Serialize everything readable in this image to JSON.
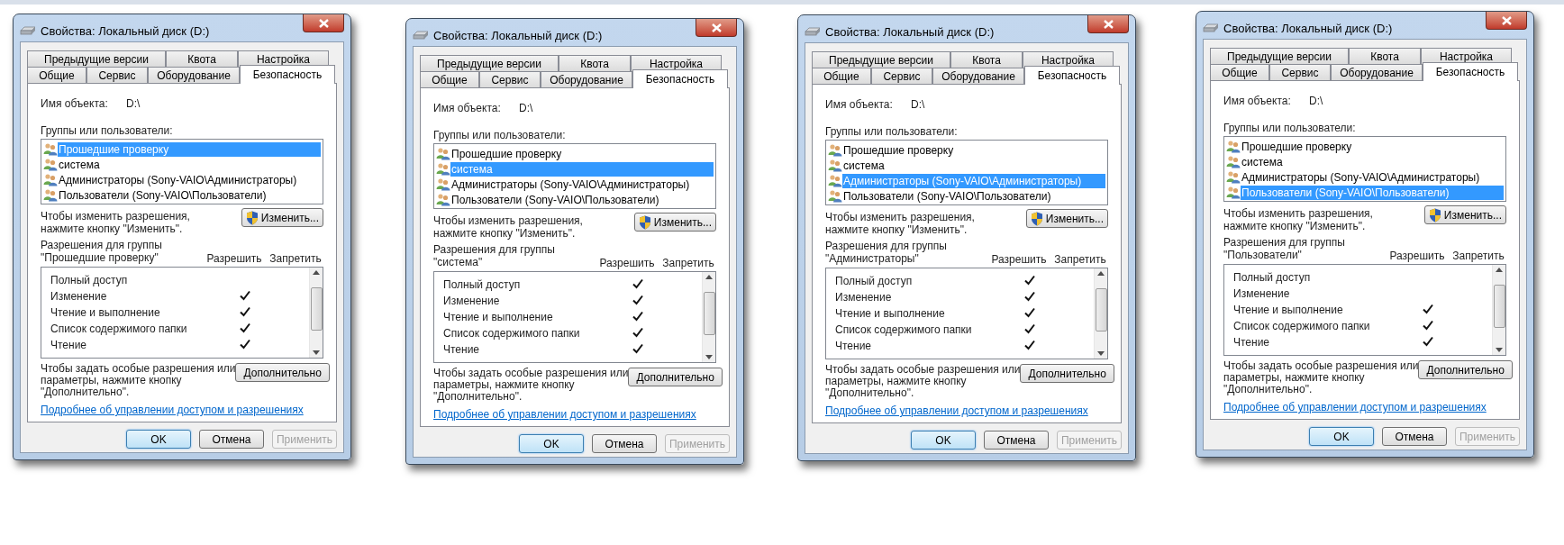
{
  "dialogs": [
    {
      "title": "Свойства: Локальный диск (D:)",
      "tabs_top": [
        {
          "label": "Предыдущие версии",
          "selected": false
        },
        {
          "label": "Квота",
          "selected": false
        },
        {
          "label": "Настройка",
          "selected": false
        }
      ],
      "tabs_bottom": [
        {
          "label": "Общие",
          "selected": false
        },
        {
          "label": "Сервис",
          "selected": false
        },
        {
          "label": "Оборудование",
          "selected": false
        },
        {
          "label": "Безопасность",
          "selected": true
        }
      ],
      "object_label": "Имя объекта:",
      "object_value": "D:\\",
      "groups_label": "Группы или пользователи:",
      "principals": [
        {
          "name": "Прошедшие проверку",
          "selected": true
        },
        {
          "name": "система",
          "selected": false
        },
        {
          "name": "Администраторы (Sony-VAIO\\Администраторы)",
          "selected": false
        },
        {
          "name": "Пользователи (Sony-VAIO\\Пользователи)",
          "selected": false
        }
      ],
      "change_hint": "Чтобы изменить разрешения,\nнажмите кнопку \"Изменить\".",
      "change_button": "Изменить...",
      "permissions_label": "Разрешения для группы\n\"Прошедшие проверку\"",
      "allow_header": "Разрешить",
      "deny_header": "Запретить",
      "permissions": [
        {
          "name": "Полный доступ",
          "allow": false,
          "deny": false
        },
        {
          "name": "Изменение",
          "allow": true,
          "deny": false
        },
        {
          "name": "Чтение и выполнение",
          "allow": true,
          "deny": false
        },
        {
          "name": "Список содержимого папки",
          "allow": true,
          "deny": false
        },
        {
          "name": "Чтение",
          "allow": true,
          "deny": false
        }
      ],
      "advanced_hint": "Чтобы задать особые разрешения или\nпараметры, нажмите кнопку\n\"Дополнительно\".",
      "advanced_button": "Дополнительно",
      "help_link": "Подробнее об управлении доступом и разрешениях",
      "buttons": [
        {
          "label": "OK",
          "default": true,
          "disabled": false
        },
        {
          "label": "Отмена",
          "default": false,
          "disabled": false
        },
        {
          "label": "Применить",
          "default": false,
          "disabled": true
        }
      ]
    },
    {
      "title": "Свойства: Локальный диск (D:)",
      "tabs_top": [
        {
          "label": "Предыдущие версии",
          "selected": false
        },
        {
          "label": "Квота",
          "selected": false
        },
        {
          "label": "Настройка",
          "selected": false
        }
      ],
      "tabs_bottom": [
        {
          "label": "Общие",
          "selected": false
        },
        {
          "label": "Сервис",
          "selected": false
        },
        {
          "label": "Оборудование",
          "selected": false
        },
        {
          "label": "Безопасность",
          "selected": true
        }
      ],
      "object_label": "Имя объекта:",
      "object_value": "D:\\",
      "groups_label": "Группы или пользователи:",
      "principals": [
        {
          "name": "Прошедшие проверку",
          "selected": false
        },
        {
          "name": "система",
          "selected": true
        },
        {
          "name": "Администраторы (Sony-VAIO\\Администраторы)",
          "selected": false
        },
        {
          "name": "Пользователи (Sony-VAIO\\Пользователи)",
          "selected": false
        }
      ],
      "change_hint": "Чтобы изменить разрешения,\nнажмите кнопку \"Изменить\".",
      "change_button": "Изменить...",
      "permissions_label": "Разрешения для группы \"система\"",
      "allow_header": "Разрешить",
      "deny_header": "Запретить",
      "permissions": [
        {
          "name": "Полный доступ",
          "allow": true,
          "deny": false
        },
        {
          "name": "Изменение",
          "allow": true,
          "deny": false
        },
        {
          "name": "Чтение и выполнение",
          "allow": true,
          "deny": false
        },
        {
          "name": "Список содержимого папки",
          "allow": true,
          "deny": false
        },
        {
          "name": "Чтение",
          "allow": true,
          "deny": false
        }
      ],
      "advanced_hint": "Чтобы задать особые разрешения или\nпараметры, нажмите кнопку\n\"Дополнительно\".",
      "advanced_button": "Дополнительно",
      "help_link": "Подробнее об управлении доступом и разрешениях",
      "buttons": [
        {
          "label": "OK",
          "default": true,
          "disabled": false
        },
        {
          "label": "Отмена",
          "default": false,
          "disabled": false
        },
        {
          "label": "Применить",
          "default": false,
          "disabled": true
        }
      ]
    },
    {
      "title": "Свойства: Локальный диск (D:)",
      "tabs_top": [
        {
          "label": "Предыдущие версии",
          "selected": false
        },
        {
          "label": "Квота",
          "selected": false
        },
        {
          "label": "Настройка",
          "selected": false
        }
      ],
      "tabs_bottom": [
        {
          "label": "Общие",
          "selected": false
        },
        {
          "label": "Сервис",
          "selected": false
        },
        {
          "label": "Оборудование",
          "selected": false
        },
        {
          "label": "Безопасность",
          "selected": true
        }
      ],
      "object_label": "Имя объекта:",
      "object_value": "D:\\",
      "groups_label": "Группы или пользователи:",
      "principals": [
        {
          "name": "Прошедшие проверку",
          "selected": false
        },
        {
          "name": "система",
          "selected": false
        },
        {
          "name": "Администраторы (Sony-VAIO\\Администраторы)",
          "selected": true
        },
        {
          "name": "Пользователи (Sony-VAIO\\Пользователи)",
          "selected": false
        }
      ],
      "change_hint": "Чтобы изменить разрешения,\nнажмите кнопку \"Изменить\".",
      "change_button": "Изменить...",
      "permissions_label": "Разрешения для группы\n\"Администраторы\"",
      "allow_header": "Разрешить",
      "deny_header": "Запретить",
      "permissions": [
        {
          "name": "Полный доступ",
          "allow": true,
          "deny": false
        },
        {
          "name": "Изменение",
          "allow": true,
          "deny": false
        },
        {
          "name": "Чтение и выполнение",
          "allow": true,
          "deny": false
        },
        {
          "name": "Список содержимого папки",
          "allow": true,
          "deny": false
        },
        {
          "name": "Чтение",
          "allow": true,
          "deny": false
        }
      ],
      "advanced_hint": "Чтобы задать особые разрешения или\nпараметры, нажмите кнопку\n\"Дополнительно\".",
      "advanced_button": "Дополнительно",
      "help_link": "Подробнее об управлении доступом и разрешениях",
      "buttons": [
        {
          "label": "OK",
          "default": true,
          "disabled": false
        },
        {
          "label": "Отмена",
          "default": false,
          "disabled": false
        },
        {
          "label": "Применить",
          "default": false,
          "disabled": true
        }
      ]
    },
    {
      "title": "Свойства: Локальный диск (D:)",
      "tabs_top": [
        {
          "label": "Предыдущие версии",
          "selected": false
        },
        {
          "label": "Квота",
          "selected": false
        },
        {
          "label": "Настройка",
          "selected": false
        }
      ],
      "tabs_bottom": [
        {
          "label": "Общие",
          "selected": false
        },
        {
          "label": "Сервис",
          "selected": false
        },
        {
          "label": "Оборудование",
          "selected": false
        },
        {
          "label": "Безопасность",
          "selected": true
        }
      ],
      "object_label": "Имя объекта:",
      "object_value": "D:\\",
      "groups_label": "Группы или пользователи:",
      "principals": [
        {
          "name": "Прошедшие проверку",
          "selected": false
        },
        {
          "name": "система",
          "selected": false
        },
        {
          "name": "Администраторы (Sony-VAIO\\Администраторы)",
          "selected": false
        },
        {
          "name": "Пользователи (Sony-VAIO\\Пользователи)",
          "selected": true
        }
      ],
      "change_hint": "Чтобы изменить разрешения,\nнажмите кнопку \"Изменить\".",
      "change_button": "Изменить...",
      "permissions_label": "Разрешения для группы\n\"Пользователи\"",
      "allow_header": "Разрешить",
      "deny_header": "Запретить",
      "permissions": [
        {
          "name": "Полный доступ",
          "allow": false,
          "deny": false
        },
        {
          "name": "Изменение",
          "allow": false,
          "deny": false
        },
        {
          "name": "Чтение и выполнение",
          "allow": true,
          "deny": false
        },
        {
          "name": "Список содержимого папки",
          "allow": true,
          "deny": false
        },
        {
          "name": "Чтение",
          "allow": true,
          "deny": false
        }
      ],
      "advanced_hint": "Чтобы задать особые разрешения или\nпараметры, нажмите кнопку\n\"Дополнительно\".",
      "advanced_button": "Дополнительно",
      "help_link": "Подробнее об управлении доступом и разрешениях",
      "buttons": [
        {
          "label": "OK",
          "default": true,
          "disabled": false
        },
        {
          "label": "Отмена",
          "default": false,
          "disabled": false
        },
        {
          "label": "Применить",
          "default": false,
          "disabled": true
        }
      ]
    }
  ]
}
